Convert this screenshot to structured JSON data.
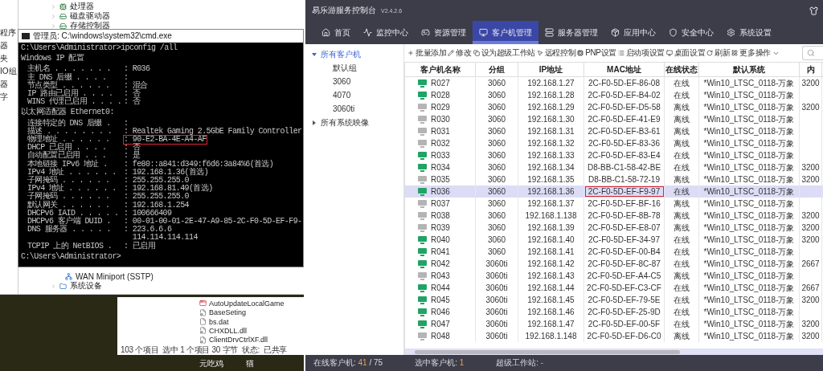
{
  "device_manager": {
    "side_pane_items": [
      "程序",
      "器",
      "夹",
      "IO组",
      "器",
      "字"
    ],
    "tree_items_top": [
      "处理器",
      "磁盘驱动器",
      "存储控制器"
    ],
    "tree_items_bottom": [
      {
        "label": "WAN Miniport (SSTP)",
        "kind": "device"
      },
      {
        "label": "系统设备",
        "kind": "category"
      }
    ]
  },
  "cmd_window": {
    "title": "管理员: C:\\windows\\system32\\cmd.exe",
    "lines": [
      {
        "kind": "text",
        "text": "C:\\Users\\Administrator>ipconfig /all"
      },
      {
        "kind": "blank"
      },
      {
        "kind": "text",
        "text": "Windows IP 配置"
      },
      {
        "kind": "blank"
      },
      {
        "kind": "field",
        "label": "主机名 . . . . . . .",
        "value": ": R036",
        "highlighted": false
      },
      {
        "kind": "field",
        "label": "主 DNS 后缀 . . . .",
        "value": ":",
        "highlighted": false
      },
      {
        "kind": "field",
        "label": "节点类型 . . . . . .",
        "value": ": 混合",
        "highlighted": false
      },
      {
        "kind": "field",
        "label": "IP 路由已启用 . . . .",
        "value": ": 否",
        "highlighted": false
      },
      {
        "kind": "field",
        "label": "WINS 代理已启用 . . . .",
        "value": ": 否",
        "highlighted": false
      },
      {
        "kind": "blank"
      },
      {
        "kind": "text",
        "text": "以太网适配器 Ethernet0:"
      },
      {
        "kind": "blank"
      },
      {
        "kind": "field",
        "label": "连接特定的 DNS 后缀 .",
        "value": ":",
        "highlighted": false
      },
      {
        "kind": "field",
        "label": "描述 . . . . . . . .",
        "value": ": Realtek Gaming 2.5GbE Family Controller",
        "highlighted": false
      },
      {
        "kind": "field",
        "label": "物理地址 . . . . . .",
        "value": ": 90-E2-BA-4E-A4-AF",
        "highlighted": true
      },
      {
        "kind": "field",
        "label": "DHCP 已启用 . . . .",
        "value": ": 否",
        "highlighted": false
      },
      {
        "kind": "field",
        "label": "自动配置已启用 . . .",
        "value": ": 是",
        "highlighted": false
      },
      {
        "kind": "field",
        "label": "本地链接 IPv6 地址 .",
        "value": ": fe80::a841:d349:f6d6:3a84%6(首选)",
        "highlighted": false
      },
      {
        "kind": "field",
        "label": "IPv4 地址 . . . . . .",
        "value": ": 192.168.1.36(首选)",
        "highlighted": false
      },
      {
        "kind": "field",
        "label": "子网掩码 . . . . . .",
        "value": ": 255.255.255.0",
        "highlighted": false
      },
      {
        "kind": "field",
        "label": "IPv4 地址 . . . . . .",
        "value": ": 192.168.81.49(首选)",
        "highlighted": false
      },
      {
        "kind": "field",
        "label": "子网掩码 . . . . . .",
        "value": ": 255.255.255.0",
        "highlighted": false
      },
      {
        "kind": "field",
        "label": "默认网关 . . . . . .",
        "value": ": 192.168.1.254",
        "highlighted": false
      },
      {
        "kind": "field",
        "label": "DHCPv6 IAID . . . . .",
        "value": ": 100666409",
        "highlighted": false
      },
      {
        "kind": "field",
        "label": "DHCPv6 客户端 DUID .",
        "value": ": 00-01-00-01-2E-47-A9-85-2C-F0-5D-EF-F9-",
        "highlighted": false
      },
      {
        "kind": "field",
        "label": "DNS 服务器 . . . . .",
        "value": ": 223.6.6.6",
        "highlighted": false
      },
      {
        "kind": "continuation",
        "value": "114.114.114.114"
      },
      {
        "kind": "field",
        "label": "TCPIP 上的 NetBIOS .",
        "value": ": 已启用",
        "highlighted": false
      },
      {
        "kind": "blank"
      },
      {
        "kind": "text",
        "text": "C:\\Users\\Administrator>"
      }
    ]
  },
  "explorer_window": {
    "files": [
      {
        "name": "AutoUpdateLocalGame",
        "kind": "app"
      },
      {
        "name": "BaseSeting",
        "kind": "config"
      },
      {
        "name": "bs.dat",
        "kind": "file"
      },
      {
        "name": "CHXDLL.dll",
        "kind": "config"
      },
      {
        "name": "ClientDrvCtrlXF.dll",
        "kind": "config"
      }
    ],
    "status": {
      "count": "103 个项目",
      "selection": "选中 1 个项目  30 字节",
      "state_label": "状态:",
      "state_value": "已共享"
    }
  },
  "desktop_icons": [
    "元吃鸡",
    "猫"
  ],
  "app": {
    "title": "易乐游服务控制台",
    "version": "V2.4.2.6",
    "nav_tabs": [
      {
        "label": "首页",
        "selected": false
      },
      {
        "label": "监控中心",
        "selected": false
      },
      {
        "label": "资源管理",
        "selected": false
      },
      {
        "label": "客户机管理",
        "selected": true
      },
      {
        "label": "服务器管理",
        "selected": false
      },
      {
        "label": "应用中心",
        "selected": false
      },
      {
        "label": "安全中心",
        "selected": false
      },
      {
        "label": "系统设置",
        "selected": false
      }
    ],
    "sidebar": {
      "items": [
        {
          "label": "所有客户机",
          "expanded": true,
          "selected": true,
          "children": [
            {
              "label": "默认组",
              "selected": false
            },
            {
              "label": "3060",
              "selected": false
            },
            {
              "label": "4070",
              "selected": false
            },
            {
              "label": "3060ti",
              "selected": false
            }
          ]
        },
        {
          "label": "所有系统映像",
          "expanded": false,
          "selected": false
        }
      ]
    },
    "toolbar": [
      "批量添加",
      "修改",
      "设为超级工作站",
      "远程控制",
      "PNP设置",
      "启动项设置",
      "桌面设置",
      "刷新",
      "更多操作"
    ],
    "table": {
      "columns": [
        "客户机名称",
        "分组",
        "IP地址",
        "MAC地址",
        "在线状态",
        "默认系统",
        "内"
      ],
      "rows": [
        {
          "name": "R027",
          "group": "3060",
          "ip": "192.168.1.27",
          "mac": "2C-F0-5D-EF-86-08",
          "online": true,
          "status": "在线",
          "system": "*Win10_LTSC_0118-万象",
          "memory": "3200",
          "selected": false,
          "mac_highlighted": false
        },
        {
          "name": "R028",
          "group": "3060",
          "ip": "192.168.1.28",
          "mac": "2C-F0-5D-EF-B4-02",
          "online": true,
          "status": "在线",
          "system": "*Win10_LTSC_0118-万象",
          "selected": false,
          "mac_highlighted": false
        },
        {
          "name": "R029",
          "group": "3060",
          "ip": "192.168.1.29",
          "mac": "2C-F0-5D-EF-D5-58",
          "online": false,
          "status": "离线",
          "system": "*Win10_LTSC_0118-万象",
          "memory": "3200",
          "selected": false,
          "mac_highlighted": false
        },
        {
          "name": "R030",
          "group": "3060",
          "ip": "192.168.1.30",
          "mac": "2C-F0-5D-EF-41-E9",
          "online": false,
          "status": "离线",
          "system": "*Win10_LTSC_0118-万象",
          "selected": false,
          "mac_highlighted": false
        },
        {
          "name": "R031",
          "group": "3060",
          "ip": "192.168.1.31",
          "mac": "2C-F0-5D-EF-B3-61",
          "online": false,
          "status": "离线",
          "system": "*Win10_LTSC_0118-万象",
          "selected": false,
          "mac_highlighted": false
        },
        {
          "name": "R032",
          "group": "3060",
          "ip": "192.168.1.32",
          "mac": "2C-F0-5D-EF-83-36",
          "online": false,
          "status": "离线",
          "system": "*Win10_LTSC_0118-万象",
          "selected": false,
          "mac_highlighted": false
        },
        {
          "name": "R033",
          "group": "3060",
          "ip": "192.168.1.33",
          "mac": "2C-F0-5D-EF-83-E4",
          "online": true,
          "status": "在线",
          "system": "*Win10_LTSC_0118-万象",
          "selected": false,
          "mac_highlighted": false
        },
        {
          "name": "R034",
          "group": "3060",
          "ip": "192.168.1.34",
          "mac": "D8-BB-C1-58-42-BE",
          "online": true,
          "status": "在线",
          "system": "*Win10_LTSC_0118-万象",
          "memory": "3200",
          "selected": false,
          "mac_highlighted": false
        },
        {
          "name": "R035",
          "group": "3060",
          "ip": "192.168.1.35",
          "mac": "D8-BB-C1-58-72-19",
          "online": false,
          "status": "离线",
          "system": "*Win10_LTSC_0118-万象",
          "memory": "3200",
          "selected": false,
          "mac_highlighted": false
        },
        {
          "name": "R036",
          "group": "3060",
          "ip": "192.168.1.36",
          "mac": "2C-F0-5D-EF-F9-97",
          "online": true,
          "status": "在线",
          "system": "*Win10_LTSC_0118-万象",
          "selected": true,
          "mac_highlighted": true
        },
        {
          "name": "R037",
          "group": "3060",
          "ip": "192.168.1.37",
          "mac": "2C-F0-5D-EF-BF-16",
          "online": false,
          "status": "离线",
          "system": "*Win10_LTSC_0118-万象",
          "selected": false,
          "mac_highlighted": false
        },
        {
          "name": "R038",
          "group": "3060",
          "ip": "192.168.1.138",
          "mac": "2C-F0-5D-EF-8B-78",
          "online": false,
          "status": "离线",
          "system": "*Win10_LTSC_0118-万象",
          "memory": "3200",
          "selected": false,
          "mac_highlighted": false
        },
        {
          "name": "R039",
          "group": "3060",
          "ip": "192.168.1.39",
          "mac": "2C-F0-5D-EF-E8-07",
          "online": false,
          "status": "离线",
          "system": "*Win10_LTSC_0118-万象",
          "memory": "3200",
          "selected": false,
          "mac_highlighted": false
        },
        {
          "name": "R040",
          "group": "3060",
          "ip": "192.168.1.40",
          "mac": "2C-F0-5D-EF-34-97",
          "online": true,
          "status": "在线",
          "system": "*Win10_LTSC_0118-万象",
          "memory": "3200",
          "selected": false,
          "mac_highlighted": false
        },
        {
          "name": "R041",
          "group": "3060",
          "ip": "192.168.1.41",
          "mac": "2C-F0-5D-EF-00-B4",
          "online": true,
          "status": "在线",
          "system": "*Win10_LTSC_0118-万象",
          "selected": false,
          "mac_highlighted": false
        },
        {
          "name": "R042",
          "group": "3060ti",
          "ip": "192.168.1.42",
          "mac": "2C-F0-5D-EF-8C-87",
          "online": true,
          "status": "在线",
          "system": "*Win10_LTSC_0118-万象",
          "memory": "2667",
          "selected": false,
          "mac_highlighted": false
        },
        {
          "name": "R043",
          "group": "3060ti",
          "ip": "192.168.1.43",
          "mac": "2C-F0-5D-EF-A4-C5",
          "online": false,
          "status": "离线",
          "system": "*Win10_LTSC_0118-万象",
          "selected": false,
          "mac_highlighted": false
        },
        {
          "name": "R044",
          "group": "3060ti",
          "ip": "192.168.1.44",
          "mac": "2C-F0-5D-EF-C3-CF",
          "online": true,
          "status": "在线",
          "system": "*Win10_LTSC_0118-万象",
          "memory": "2667",
          "selected": false,
          "mac_highlighted": false
        },
        {
          "name": "R045",
          "group": "3060ti",
          "ip": "192.168.1.45",
          "mac": "2C-F0-5D-EF-79-5E",
          "online": true,
          "status": "在线",
          "system": "*Win10_LTSC_0118-万象",
          "memory": "3200",
          "selected": false,
          "mac_highlighted": false
        },
        {
          "name": "R046",
          "group": "3060ti",
          "ip": "192.168.1.46",
          "mac": "2C-F0-5D-EF-25-9D",
          "online": true,
          "status": "在线",
          "system": "*Win10_LTSC_0118-万象",
          "selected": false,
          "mac_highlighted": false
        },
        {
          "name": "R047",
          "group": "3060ti",
          "ip": "192.168.1.47",
          "mac": "2C-F0-5D-EF-00-5F",
          "online": true,
          "status": "在线",
          "system": "*Win10_LTSC_0118-万象",
          "memory": "3200",
          "selected": false,
          "mac_highlighted": false
        },
        {
          "name": "R048",
          "group": "3060ti",
          "ip": "192.168.1.148",
          "mac": "2C-F0-5D-EF-D6-C0",
          "online": false,
          "status": "离线",
          "system": "*Win10_LTSC_0118-万象",
          "memory": "3200",
          "selected": false,
          "mac_highlighted": false
        }
      ]
    },
    "status_bar": [
      {
        "label": "在线客户机:",
        "value": "41",
        "suffix": "/ 75"
      },
      {
        "label": "选中客户机:",
        "value": "1"
      },
      {
        "label": "超级工作站:",
        "value": "-"
      }
    ]
  }
}
